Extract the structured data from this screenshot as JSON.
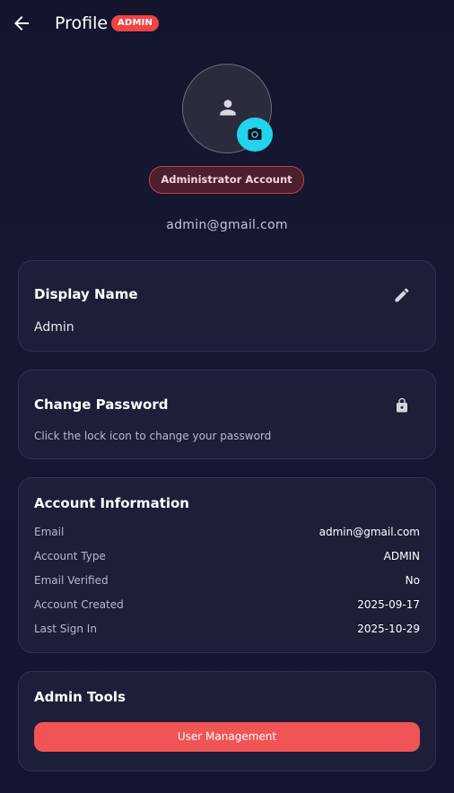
{
  "header": {
    "back_icon": "arrow-left-icon",
    "title": "Profile",
    "badge": "ADMIN"
  },
  "avatar": {
    "placeholder_icon": "person-icon",
    "camera_icon": "camera-icon",
    "role_label": "Administrator Account",
    "email": "admin@gmail.com"
  },
  "display_name_card": {
    "title": "Display Name",
    "value": "Admin",
    "edit_icon": "pencil-icon"
  },
  "password_card": {
    "title": "Change Password",
    "description": "Click the lock icon to change your password",
    "lock_icon": "lock-icon"
  },
  "account_info": {
    "title": "Account Information",
    "rows": [
      {
        "label": "Email",
        "value": "admin@gmail.com"
      },
      {
        "label": "Account Type",
        "value": "ADMIN"
      },
      {
        "label": "Email Verified",
        "value": "No"
      },
      {
        "label": "Account Created",
        "value": "2025-09-17"
      },
      {
        "label": "Last Sign In",
        "value": "2025-10-29"
      }
    ]
  },
  "admin_tools": {
    "title": "Admin Tools",
    "user_management_label": "User Management"
  },
  "colors": {
    "background": "#14152d",
    "card": "#1d1f38",
    "accent_red": "#ef4444",
    "camera_cyan": "#22d3ee",
    "button_red": "#f05454"
  }
}
